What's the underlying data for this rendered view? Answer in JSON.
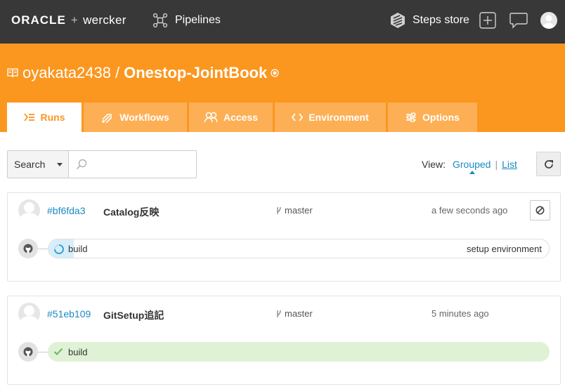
{
  "topbar": {
    "brand_oracle": "ORACLE",
    "brand_plus": "+",
    "brand_wercker": "wercker",
    "pipelines_label": "Pipelines",
    "steps_store_label": "Steps store"
  },
  "repo": {
    "owner": "oyakata2438",
    "separator": "/",
    "name": "Onestop-JointBook"
  },
  "tabs": [
    {
      "label": "Runs",
      "icon": "runs-icon",
      "active": true
    },
    {
      "label": "Workflows",
      "icon": "workflows-icon",
      "active": false
    },
    {
      "label": "Access",
      "icon": "access-icon",
      "active": false
    },
    {
      "label": "Environment",
      "icon": "code-icon",
      "active": false
    },
    {
      "label": "Options",
      "icon": "options-icon",
      "active": false
    }
  ],
  "toolbar": {
    "search_select_value": "Search",
    "search_placeholder": "",
    "view_label": "View:",
    "view_grouped": "Grouped",
    "view_separator": "|",
    "view_list": "List"
  },
  "runs": [
    {
      "commit": "#bf6fda3",
      "message": "Catalog反映",
      "branch": "master",
      "time": "a few seconds ago",
      "pipeline": "build",
      "pipeline_status": "setup environment",
      "state": "running"
    },
    {
      "commit": "#51eb109",
      "message": "GitSetup追記",
      "branch": "master",
      "time": "5 minutes ago",
      "pipeline": "build",
      "pipeline_status": "",
      "state": "passed"
    }
  ],
  "colors": {
    "topbar": "#383838",
    "header": "#fb961f",
    "tab_inactive": "#fdaf55",
    "link": "#1a8bc2",
    "running_fill": "#d8eef9",
    "passed_fill": "#e0f2d6",
    "passed_check": "#5cb85c"
  }
}
